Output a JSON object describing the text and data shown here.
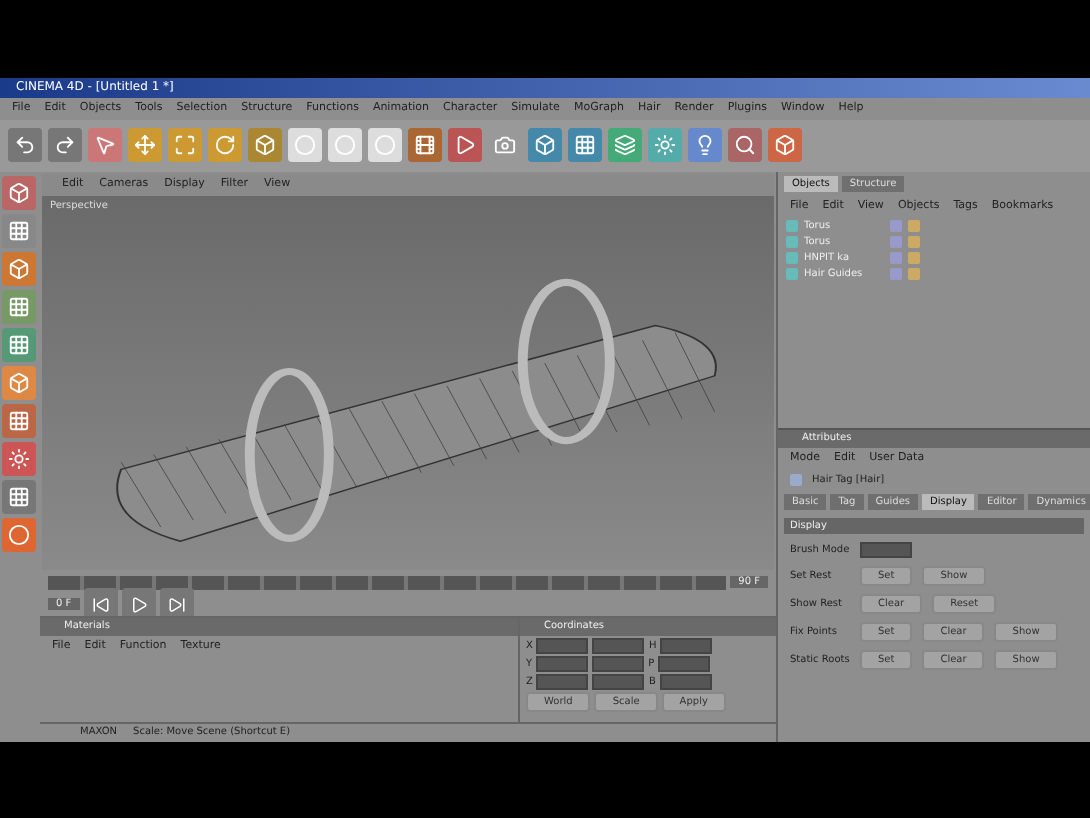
{
  "window": {
    "title": "CINEMA 4D - [Untitled 1 *]"
  },
  "menu": [
    "File",
    "Edit",
    "Objects",
    "Tools",
    "Selection",
    "Structure",
    "Functions",
    "Animation",
    "Character",
    "Simulate",
    "MoGraph",
    "Hair",
    "Render",
    "Plugins",
    "Window",
    "Help"
  ],
  "viewport": {
    "menu": [
      "Edit",
      "Cameras",
      "Display",
      "Filter",
      "View"
    ],
    "label": "Perspective"
  },
  "object_manager": {
    "tabs": [
      {
        "label": "Objects",
        "selected": true
      },
      {
        "label": "Structure",
        "selected": false
      }
    ],
    "menu": [
      "File",
      "Edit",
      "View",
      "Objects",
      "Tags",
      "Bookmarks"
    ],
    "objects": [
      {
        "name": "Torus"
      },
      {
        "name": "Torus"
      },
      {
        "name": "HNPIT ka"
      },
      {
        "name": "Hair Guides"
      }
    ]
  },
  "attributes": {
    "title": "Attributes",
    "menu": [
      "Mode",
      "Edit",
      "User Data"
    ],
    "object": "Hair Tag [Hair]",
    "tabs": [
      {
        "label": "Basic",
        "selected": false
      },
      {
        "label": "Tag",
        "selected": false
      },
      {
        "label": "Guides",
        "selected": false
      },
      {
        "label": "Display",
        "selected": true
      },
      {
        "label": "Editor",
        "selected": false
      },
      {
        "label": "Dynamics",
        "selected": false
      }
    ],
    "section": "Display",
    "mode_label": "Brush Mode",
    "rows": [
      {
        "label": "Set Rest",
        "buttons": [
          "Set",
          "Show"
        ]
      },
      {
        "label": "Show Rest",
        "buttons": [
          "Clear",
          "Reset"
        ]
      },
      {
        "label": "Fix Points",
        "buttons": [
          "Set",
          "Clear",
          "Show"
        ]
      },
      {
        "label": "Static Roots",
        "buttons": [
          "Set",
          "Clear",
          "Show"
        ]
      }
    ]
  },
  "timeline": {
    "frame": "0 F",
    "end": "90 F"
  },
  "materials": {
    "title": "Materials",
    "menu": [
      "File",
      "Edit",
      "Function",
      "Texture"
    ]
  },
  "coordinates": {
    "title": "Coordinates",
    "axes": [
      "X",
      "Y",
      "Z"
    ],
    "rot": [
      "H",
      "P",
      "B"
    ],
    "buttons": [
      "World",
      "Scale",
      "Apply"
    ]
  },
  "status": "Scale: Move Scene (Shortcut E)",
  "brand": "MAXON"
}
